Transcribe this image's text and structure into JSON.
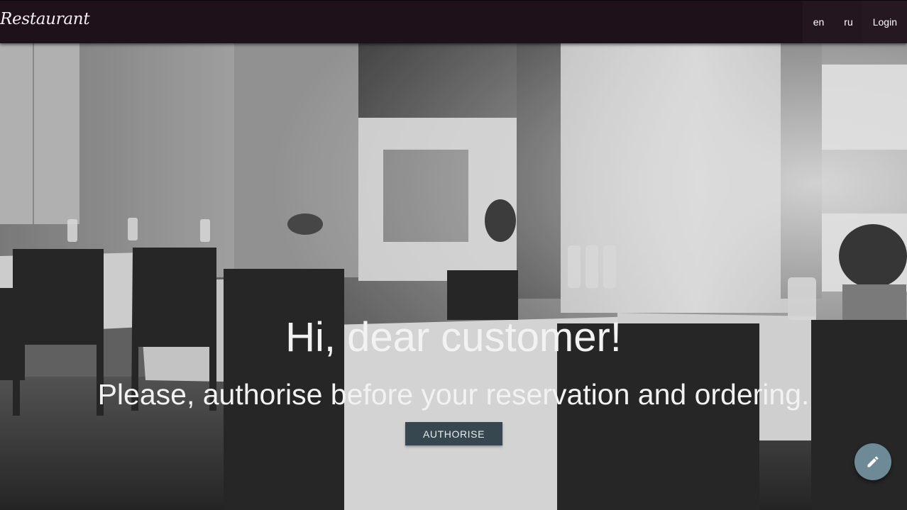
{
  "navbar": {
    "brand": "Restaurant",
    "links": [
      {
        "label": "en"
      },
      {
        "label": "ru"
      },
      {
        "label": "Login"
      }
    ]
  },
  "hero": {
    "title": "Hi, dear customer!",
    "subtitle": "Please, authorise before your reservation and ordering.",
    "authorise_label": "AUTHORISE",
    "background_image": "black-and-white-restaurant-dining-room-icon"
  },
  "fab": {
    "icon": "pencil-icon"
  },
  "colors": {
    "navbar_bg": "#1e1119",
    "button_bg": "#37474f",
    "fab_bg": "#6e8a96",
    "text_light": "#f2f2f2"
  }
}
